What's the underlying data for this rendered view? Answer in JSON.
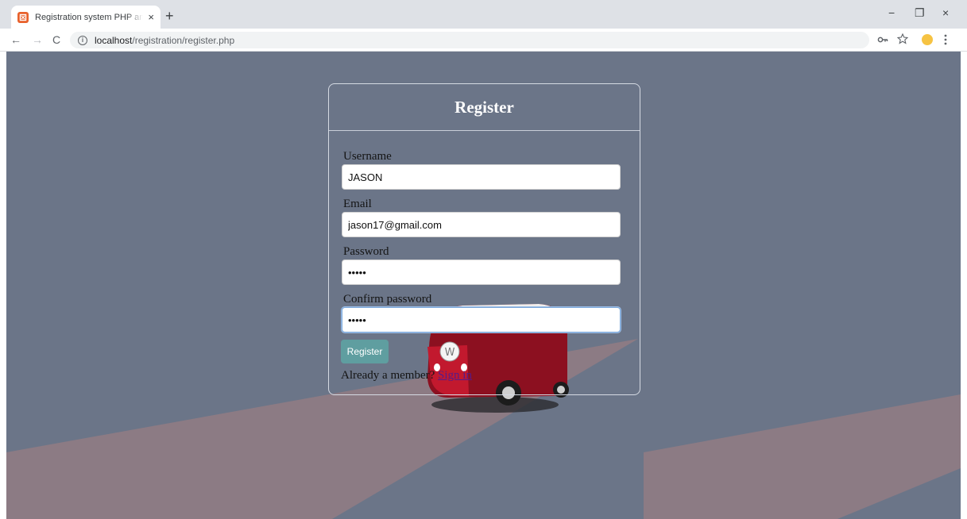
{
  "browser": {
    "tab_title": "Registration system PHP and MySQL",
    "tab_close_glyph": "×",
    "new_tab_glyph": "+",
    "url_host": "localhost",
    "url_path": "/registration/register.php",
    "window_controls": {
      "minimize": "−",
      "restore": "❐",
      "close": "×"
    },
    "nav": {
      "back": "←",
      "forward": "→",
      "reload": "C"
    },
    "toolbar_icons": [
      "key-icon",
      "star-icon",
      "profile-avatar",
      "menu-icon"
    ]
  },
  "page": {
    "title": "Register",
    "fields": [
      {
        "label": "Username",
        "value": "JASON",
        "type": "text"
      },
      {
        "label": "Email",
        "value": "jason17@gmail.com",
        "type": "email"
      },
      {
        "label": "Password",
        "value": "12345",
        "type": "password"
      },
      {
        "label": "Confirm password",
        "value": "12345",
        "type": "password"
      }
    ],
    "submit_label": "Register",
    "member_prompt": "Already a member? ",
    "signin_label": "Sign in"
  },
  "colors": {
    "page_background": "#6b7588",
    "beam": "#8c7b84",
    "button": "#5f9ea0",
    "link": "#551a8b",
    "bus_red": "#8c1020"
  }
}
